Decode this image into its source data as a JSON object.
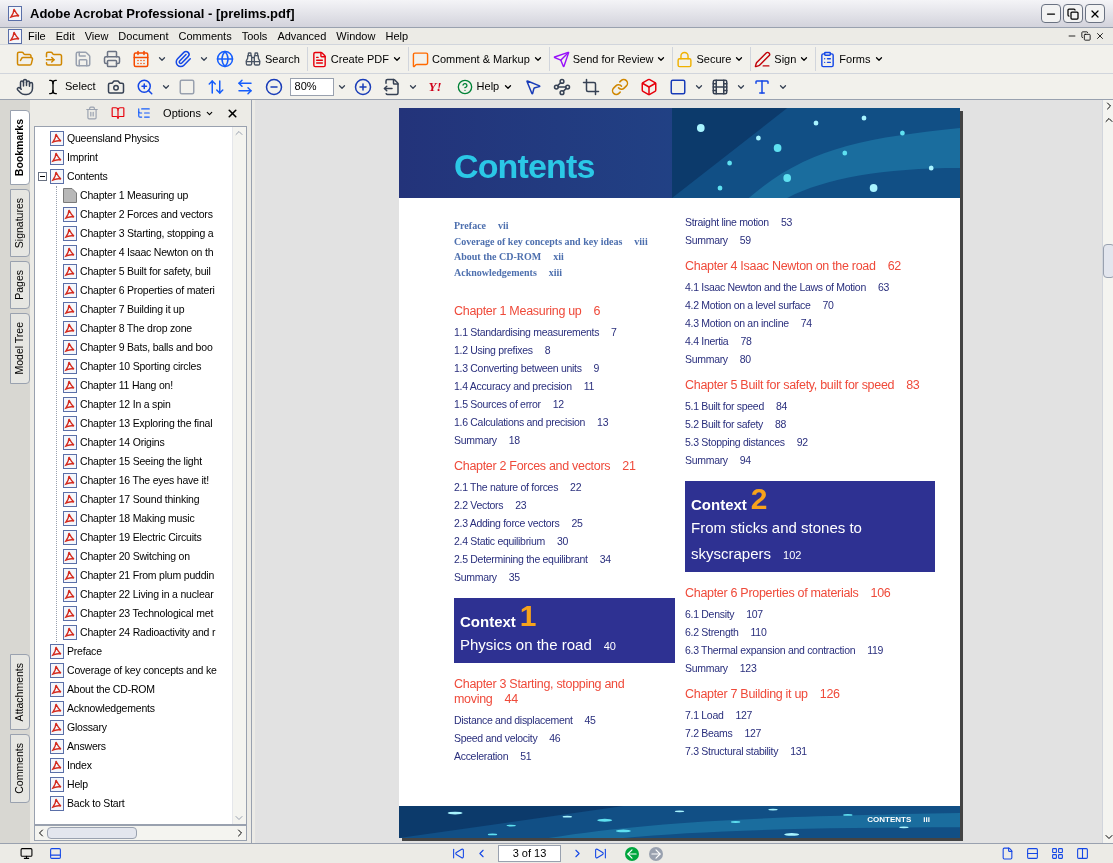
{
  "window": {
    "title": "Adobe Acrobat Professional - [prelims.pdf]"
  },
  "menu": [
    "File",
    "Edit",
    "View",
    "Document",
    "Comments",
    "Tools",
    "Advanced",
    "Window",
    "Help"
  ],
  "toolbar_top": {
    "search": "Search",
    "buttons": [
      "Create PDF",
      "Comment & Markup",
      "Send for Review",
      "Secure",
      "Sign",
      "Forms"
    ]
  },
  "toolbar_bottom": {
    "select": "Select",
    "zoom": "80%",
    "logo": "Y!",
    "help": "Help"
  },
  "side_tabs": [
    {
      "label": "Bookmarks",
      "selected": true
    },
    {
      "label": "Signatures",
      "selected": false
    },
    {
      "label": "Pages",
      "selected": false
    },
    {
      "label": "Model Tree",
      "selected": false
    }
  ],
  "side_tabs_bottom": [
    {
      "label": "Attachments",
      "selected": false
    },
    {
      "label": "Comments",
      "selected": false
    }
  ],
  "bookmarks": {
    "options": "Options",
    "items": [
      {
        "label": "Queensland Physics",
        "kind": "pdf"
      },
      {
        "label": "Imprint",
        "kind": "pdf"
      },
      {
        "label": "Contents",
        "kind": "pdf",
        "expanded": true,
        "children": [
          {
            "label": "Chapter 1 Measuring up",
            "kind": "page"
          },
          {
            "label": "Chapter 2 Forces and vectors",
            "kind": "pdf"
          },
          {
            "label": "Chapter 3 Starting, stopping a",
            "kind": "pdf"
          },
          {
            "label": "Chapter 4 Isaac Newton on th",
            "kind": "pdf"
          },
          {
            "label": "Chapter 5 Built for safety, buil",
            "kind": "pdf"
          },
          {
            "label": "Chapter 6 Properties of materi",
            "kind": "pdf"
          },
          {
            "label": "Chapter 7 Building it up",
            "kind": "pdf"
          },
          {
            "label": "Chapter 8 The drop zone",
            "kind": "pdf"
          },
          {
            "label": "Chapter 9 Bats, balls and boo",
            "kind": "pdf"
          },
          {
            "label": "Chapter 10 Sporting circles",
            "kind": "pdf"
          },
          {
            "label": "Chapter 11 Hang on!",
            "kind": "pdf"
          },
          {
            "label": "Chapter 12 In a spin",
            "kind": "pdf"
          },
          {
            "label": "Chapter 13 Exploring the final",
            "kind": "pdf"
          },
          {
            "label": "Chapter 14 Origins",
            "kind": "pdf"
          },
          {
            "label": "Chapter 15 Seeing the light",
            "kind": "pdf"
          },
          {
            "label": "Chapter 16 The eyes have it!",
            "kind": "pdf"
          },
          {
            "label": "Chapter 17 Sound thinking",
            "kind": "pdf"
          },
          {
            "label": "Chapter 18 Making music",
            "kind": "pdf"
          },
          {
            "label": "Chapter 19 Electric Circuits",
            "kind": "pdf"
          },
          {
            "label": "Chapter 20 Switching on",
            "kind": "pdf"
          },
          {
            "label": "Chapter 21 From plum puddin",
            "kind": "pdf"
          },
          {
            "label": "Chapter 22 Living in a nuclear",
            "kind": "pdf"
          },
          {
            "label": "Chapter 23 Technological met",
            "kind": "pdf"
          },
          {
            "label": "Chapter 24 Radioactivity and r",
            "kind": "pdf"
          }
        ]
      },
      {
        "label": "Preface",
        "kind": "pdf"
      },
      {
        "label": "Coverage of key concepts and ke",
        "kind": "pdf"
      },
      {
        "label": "About the CD-ROM",
        "kind": "pdf"
      },
      {
        "label": "Acknowledgements",
        "kind": "pdf"
      },
      {
        "label": "Glossary",
        "kind": "pdf"
      },
      {
        "label": "Answers",
        "kind": "pdf"
      },
      {
        "label": "Index",
        "kind": "pdf"
      },
      {
        "label": "Help",
        "kind": "pdf"
      },
      {
        "label": "Back to Start",
        "kind": "pdf"
      }
    ]
  },
  "document": {
    "heading": "Contents",
    "front_matter": [
      {
        "title": "Preface",
        "page": "vii"
      },
      {
        "title": "Coverage of key concepts and key ideas",
        "page": "viii"
      },
      {
        "title": "About the CD-ROM",
        "page": "xii"
      },
      {
        "title": "Acknowledgements",
        "page": "xiii"
      }
    ],
    "columns": [
      [
        {
          "kind": "chapter",
          "title": "Chapter 1 Measuring up",
          "page": "6"
        },
        {
          "kind": "entry",
          "title": "1.1 Standardising measurements",
          "page": "7"
        },
        {
          "kind": "entry",
          "title": "1.2 Using prefixes",
          "page": "8"
        },
        {
          "kind": "entry",
          "title": "1.3 Converting between units",
          "page": "9"
        },
        {
          "kind": "entry",
          "title": "1.4 Accuracy and precision",
          "page": "11"
        },
        {
          "kind": "entry",
          "title": "1.5 Sources of error",
          "page": "12"
        },
        {
          "kind": "entry",
          "title": "1.6 Calculations and precision",
          "page": "13"
        },
        {
          "kind": "entry",
          "title": "Summary",
          "page": "18"
        },
        {
          "kind": "chapter",
          "title": "Chapter 2 Forces and vectors",
          "page": "21"
        },
        {
          "kind": "entry",
          "title": "2.1 The nature of forces",
          "page": "22"
        },
        {
          "kind": "entry",
          "title": "2.2 Vectors",
          "page": "23"
        },
        {
          "kind": "entry",
          "title": "2.3 Adding force vectors",
          "page": "25"
        },
        {
          "kind": "entry",
          "title": "2.4 Static equilibrium",
          "page": "30"
        },
        {
          "kind": "entry",
          "title": "2.5 Determining the equilibrant",
          "page": "34"
        },
        {
          "kind": "entry",
          "title": "Summary",
          "page": "35"
        },
        {
          "kind": "context",
          "label": "Context",
          "number": "1",
          "title": "Physics on the road",
          "page": "40"
        },
        {
          "kind": "chapter",
          "title": "Chapter 3 Starting, stopping and moving",
          "page": "44"
        },
        {
          "kind": "entry",
          "title": "Distance and displacement",
          "page": "45"
        },
        {
          "kind": "entry",
          "title": "Speed and velocity",
          "page": "46"
        },
        {
          "kind": "entry",
          "title": "Acceleration",
          "page": "51"
        }
      ],
      [
        {
          "kind": "entry",
          "title": "Straight line motion",
          "page": "53"
        },
        {
          "kind": "entry",
          "title": "Summary",
          "page": "59"
        },
        {
          "kind": "chapter",
          "title": "Chapter 4 Isaac Newton on the road",
          "page": "62"
        },
        {
          "kind": "entry",
          "title": "4.1 Isaac Newton and the Laws of Motion",
          "page": "63"
        },
        {
          "kind": "entry",
          "title": "4.2 Motion on a level surface",
          "page": "70"
        },
        {
          "kind": "entry",
          "title": "4.3 Motion on an incline",
          "page": "74"
        },
        {
          "kind": "entry",
          "title": "4.4 Inertia",
          "page": "78"
        },
        {
          "kind": "entry",
          "title": "Summary",
          "page": "80"
        },
        {
          "kind": "chapter",
          "title": "Chapter 5 Built for safety, built for speed",
          "page": "83"
        },
        {
          "kind": "entry",
          "title": "5.1 Built for speed",
          "page": "84"
        },
        {
          "kind": "entry",
          "title": "5.2 Built for safety",
          "page": "88"
        },
        {
          "kind": "entry",
          "title": "5.3 Stopping distances",
          "page": "92"
        },
        {
          "kind": "entry",
          "title": "Summary",
          "page": "94"
        },
        {
          "kind": "context",
          "label": "Context",
          "number": "2",
          "title": "From sticks and stones to skyscrapers",
          "page": "102"
        },
        {
          "kind": "chapter",
          "title": "Chapter 6 Properties of materials",
          "page": "106"
        },
        {
          "kind": "entry",
          "title": "6.1 Density",
          "page": "107"
        },
        {
          "kind": "entry",
          "title": "6.2 Strength",
          "page": "110"
        },
        {
          "kind": "entry",
          "title": "6.3 Thermal expansion and contraction",
          "page": "119"
        },
        {
          "kind": "entry",
          "title": "Summary",
          "page": "123"
        },
        {
          "kind": "chapter",
          "title": "Chapter 7 Building it up",
          "page": "126"
        },
        {
          "kind": "entry",
          "title": "7.1 Load",
          "page": "127"
        },
        {
          "kind": "entry",
          "title": "7.2 Beams",
          "page": "127"
        },
        {
          "kind": "entry",
          "title": "7.3 Structural stability",
          "page": "131"
        }
      ]
    ],
    "footer": {
      "label": "CONTENTS",
      "page": "iii"
    }
  },
  "status_bar": {
    "page_field": "3 of 13"
  }
}
